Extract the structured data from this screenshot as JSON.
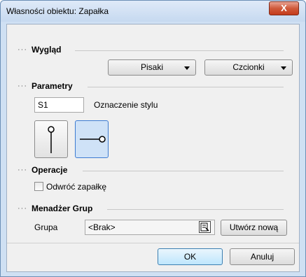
{
  "window": {
    "title": "Własności obiektu: Zapałka",
    "close_glyph": "X"
  },
  "wyglad": {
    "heading": "Wygląd",
    "pisaki_label": "Pisaki",
    "czcionki_label": "Czcionki"
  },
  "parametry": {
    "heading": "Parametry",
    "style_value": "S1",
    "style_caption": "Oznaczenie stylu",
    "options": [
      {
        "icon": "match-vertical-icon",
        "selected": false
      },
      {
        "icon": "match-horizontal-icon",
        "selected": true
      }
    ]
  },
  "operacje": {
    "heading": "Operacje",
    "reverse_label": "Odwróć zapałkę",
    "reverse_checked": false
  },
  "menadzer": {
    "heading": "Menadżer Grup",
    "group_label": "Grupa",
    "group_value": "<Brak>",
    "create_label": "Utwórz nową"
  },
  "footer": {
    "ok_label": "OK",
    "cancel_label": "Anuluj"
  },
  "colors": {
    "selected_option_bg": "#cfe2f7",
    "selected_option_border": "#3d7bd1"
  }
}
